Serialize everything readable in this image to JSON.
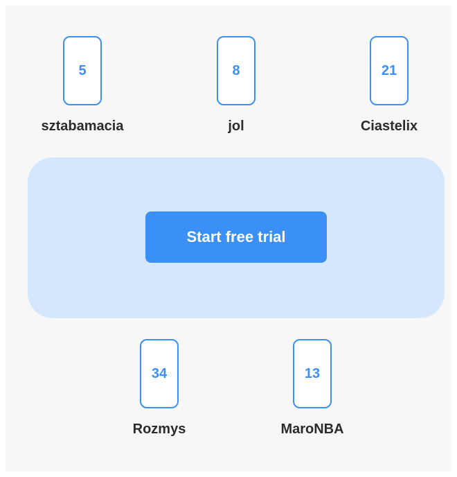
{
  "players": [
    {
      "card_value": "5",
      "name": "sztabamacia"
    },
    {
      "card_value": "8",
      "name": "jol"
    },
    {
      "card_value": "21",
      "name": "Ciastelix"
    },
    {
      "card_value": "34",
      "name": "Rozmys"
    },
    {
      "card_value": "13",
      "name": "MaroNBA"
    }
  ],
  "table": {
    "start_button_label": "Start free trial"
  },
  "colors": {
    "accent": "#3b8ff5",
    "table_bg": "#d5e7fd",
    "board_bg": "#f7f7f8",
    "name_text": "#2b2b2b"
  }
}
